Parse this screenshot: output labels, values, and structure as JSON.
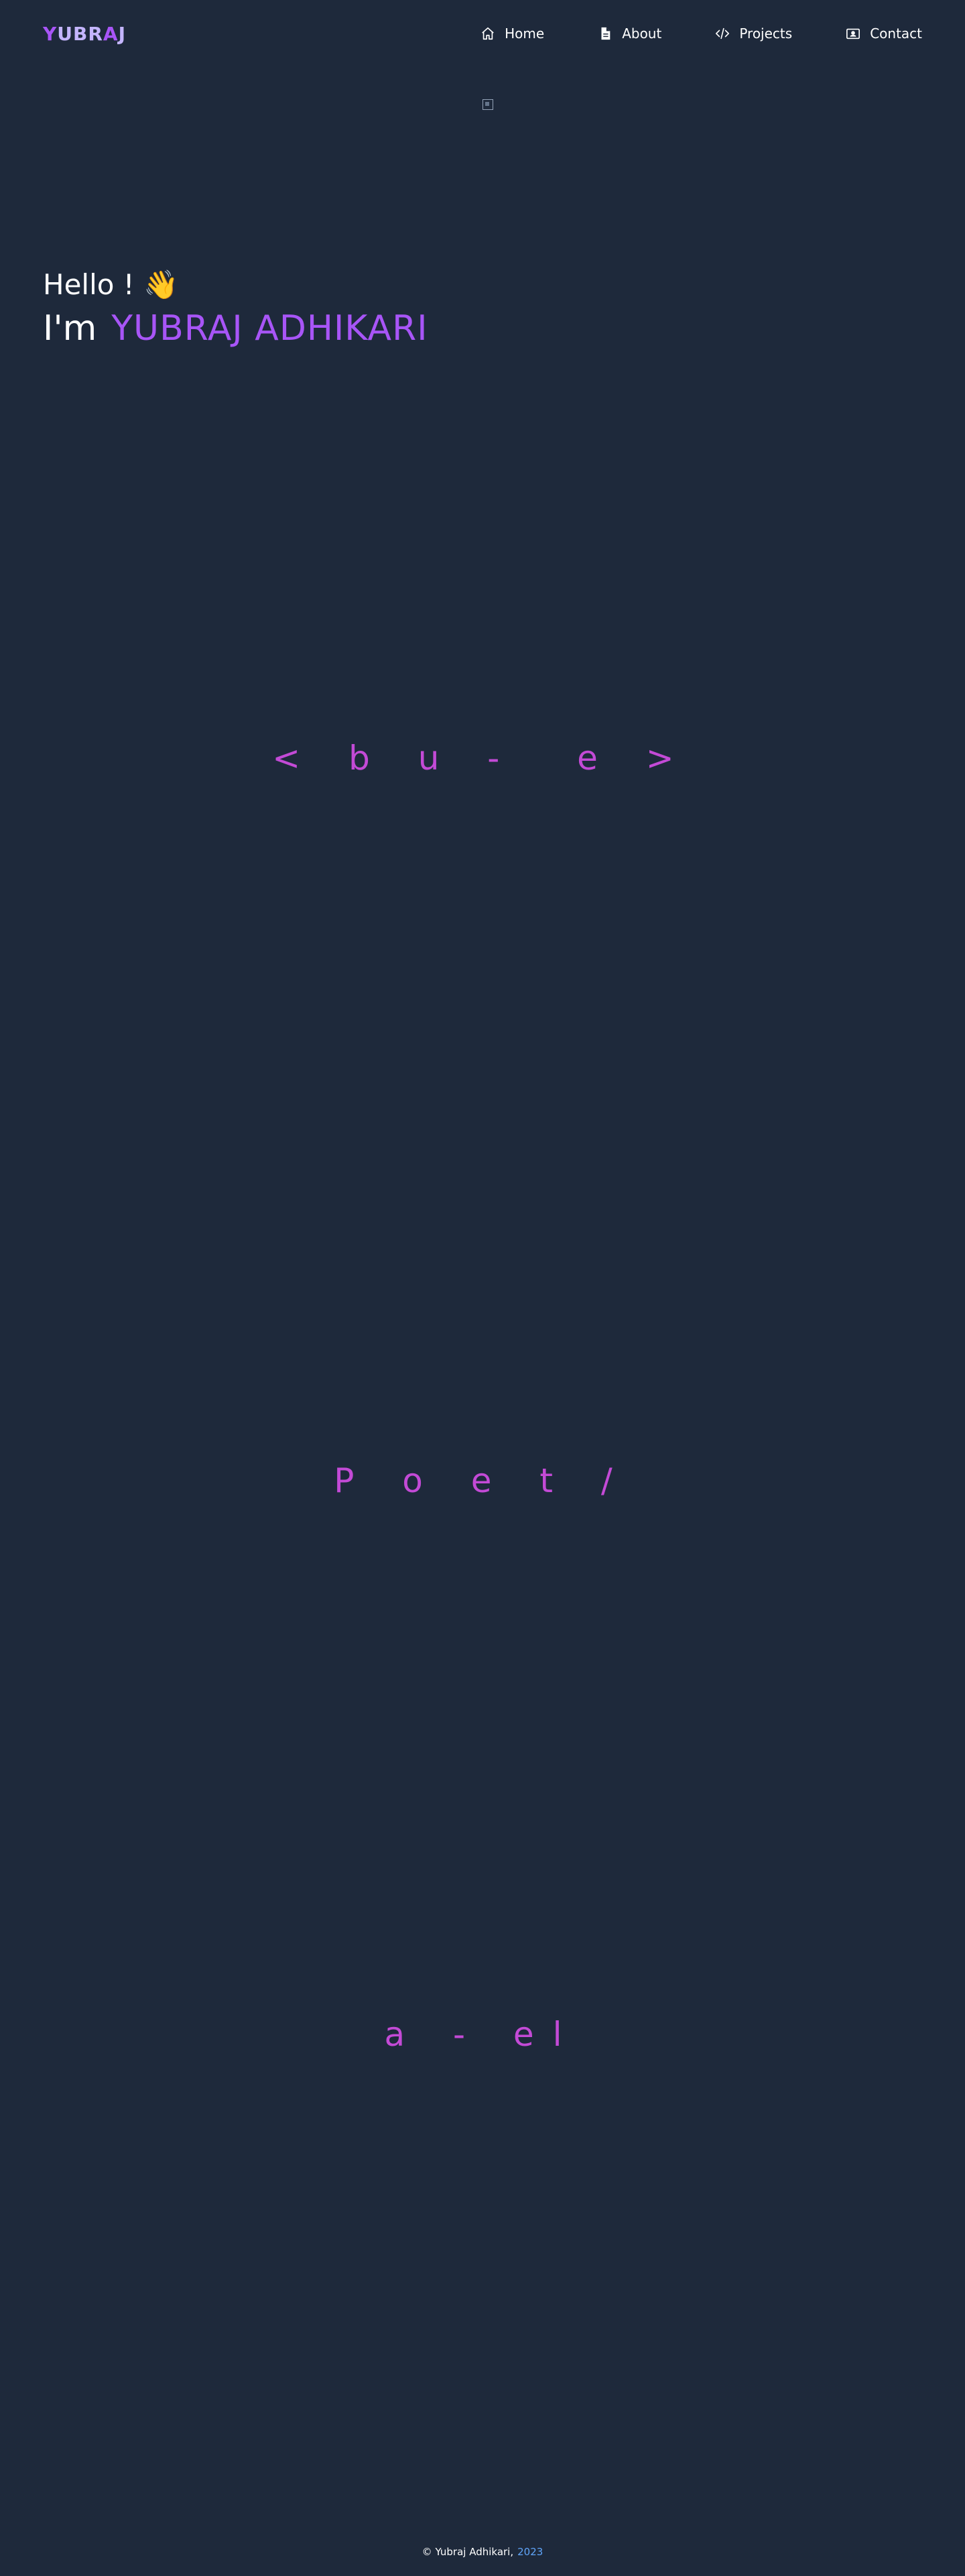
{
  "header": {
    "logo": {
      "part1": "Y",
      "part2": "UBR",
      "part3": "A",
      "part4": "J"
    },
    "nav": [
      {
        "label": "Home",
        "icon": "home-icon"
      },
      {
        "label": "About",
        "icon": "document-icon"
      },
      {
        "label": "Projects",
        "icon": "code-icon"
      },
      {
        "label": "Contact",
        "icon": "contact-icon"
      }
    ]
  },
  "hero": {
    "greeting": "Hello ! ",
    "wave_emoji": "👋",
    "intro_prefix": "I'm",
    "name": "YUBRAJ ADHIKARI"
  },
  "typewriter": {
    "line1": "< b u -  e >",
    "line2": "P o e t /",
    "line3": "a - el"
  },
  "footer": {
    "copyright": "© Yubraj Adhikari,",
    "year": "2023"
  },
  "colors": {
    "background": "#1e293b",
    "accent": "#a855f7",
    "typewriter": "#c34ad6",
    "year": "#60a5fa"
  }
}
